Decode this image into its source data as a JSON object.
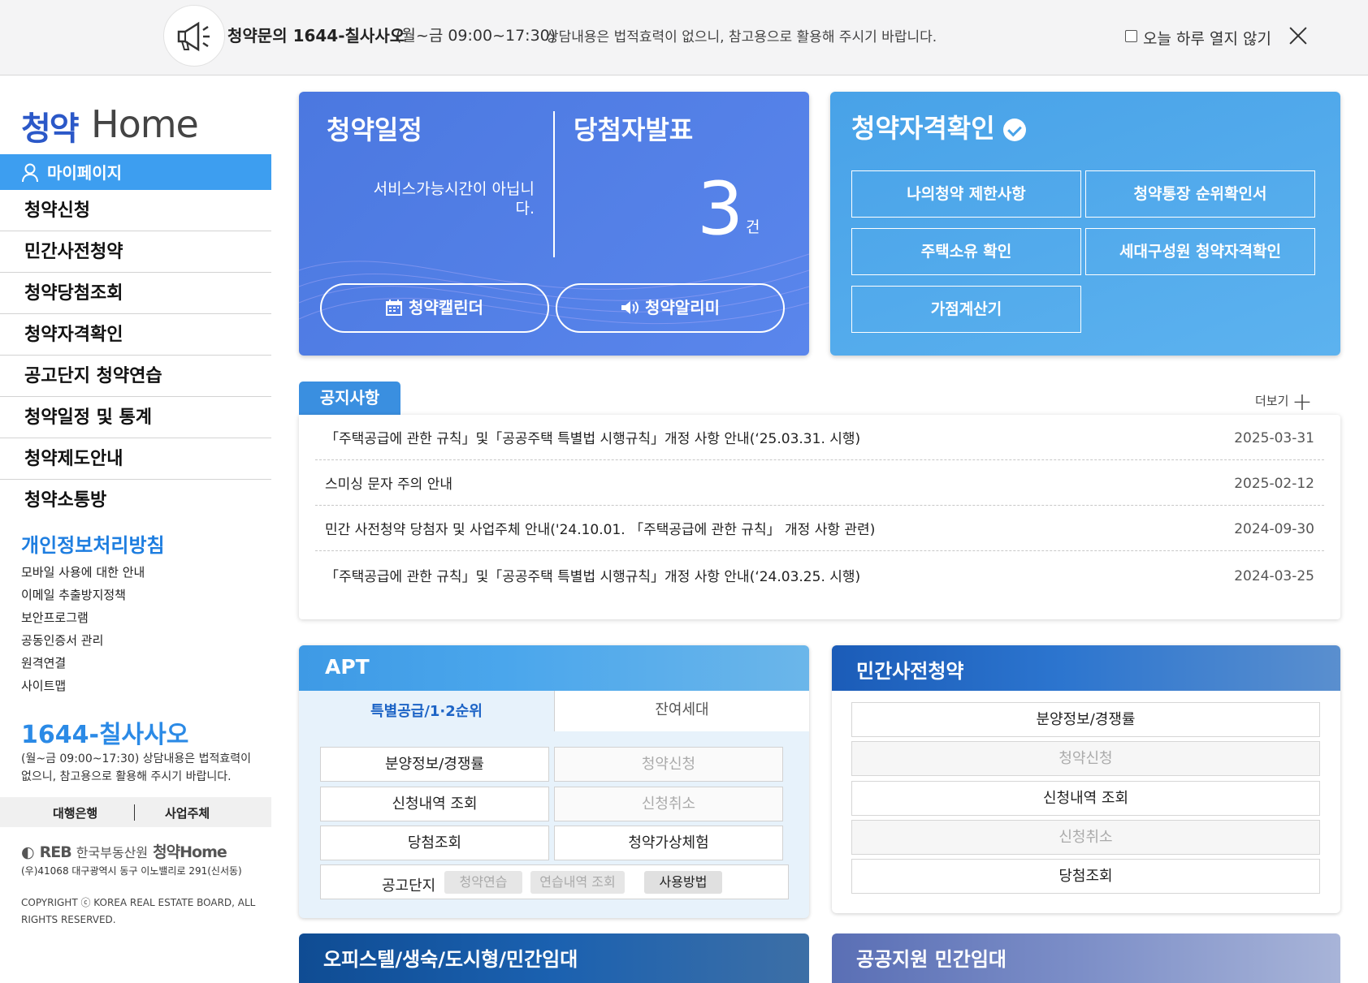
{
  "topbar": {
    "notice_bold": "청약문의 1644-칠사사오",
    "notice_hours": "(월~금 09:00~17:30)",
    "notice_desc": "상담내용은 법적효력이 없으니, 참고용으로 활용해 주시기 바랍니다.",
    "today_label": "오늘 하루 열지 않기"
  },
  "sidebar": {
    "logo_mark": "청약",
    "logo_home": "Home",
    "mypage": "마이페이지",
    "menu": [
      "청약신청",
      "민간사전청약",
      "청약당첨조회",
      "청약자격확인",
      "공고단지 청약연습",
      "청약일정 및 통계",
      "청약제도안내",
      "청약소통방"
    ],
    "privacy": "개인정보처리방침",
    "links": [
      "모바일 사용에 대한 안내",
      "이메일 추출방지정책",
      "보안프로그램",
      "공동인증서 관리",
      "원격연결",
      "사이트맵"
    ],
    "phone": "1644-칠사사오",
    "phone_desc": "(월~금 09:00~17:30) 상담내용은 법적효력이 없으니, 참고용으로 활용해 주시기 바랍니다.",
    "agency": [
      "대행은행",
      "사업주체"
    ],
    "footer_logo_reb": "REB",
    "footer_logo_name": "한국부동산원",
    "footer_logo_sub": "청약Home",
    "footer_addr": "(우)41068 대구광역시 동구 이노밸리로 291(신서동)",
    "footer_copy": "COPYRIGHT ⓒ KOREA REAL ESTATE BOARD, ALL RIGHTS RESERVED."
  },
  "schedule": {
    "title": "청약일정",
    "service_msg": "서비스가능시간이 아닙니다.",
    "winner_title": "당첨자발표",
    "winner_count": "3",
    "winner_unit": "건",
    "calendar_btn": "청약캘린더",
    "alarm_btn": "청약알리미"
  },
  "qualification": {
    "title": "청약자격확인",
    "buttons": [
      "나의청약 제한사항",
      "청약통장 순위확인서",
      "주택소유 확인",
      "세대구성원 청약자격확인",
      "가점계산기"
    ]
  },
  "notices": {
    "tab": "공지사항",
    "more": "더보기",
    "items": [
      {
        "title": "「주택공급에 관한 규칙」및「공공주택 특별법 시행규칙」개정 사항 안내(‘25.03.31. 시행)",
        "date": "2025-03-31"
      },
      {
        "title": "스미싱 문자 주의 안내",
        "date": "2025-02-12"
      },
      {
        "title": "민간 사전청약 당첨자 및 사업주체 안내('24.10.01. 「주택공급에 관한 규칙」 개정 사항 관련)",
        "date": "2024-09-30"
      },
      {
        "title": "「주택공급에 관한 규칙」및「공공주택 특별법 시행규칙」개정 사항 안내(‘24.03.25. 시행)",
        "date": "2024-03-25"
      }
    ]
  },
  "apt": {
    "title": "APT",
    "tab_active": "특별공급/1·2순위",
    "tab_other": "잔여세대",
    "buttons": [
      "분양정보/경쟁률",
      "청약신청",
      "신청내역 조회",
      "신청취소",
      "당첨조회",
      "청약가상체험"
    ],
    "row_label": "공고단지",
    "chips": [
      "청약연습",
      "연습내역 조회",
      "사용방법"
    ]
  },
  "private": {
    "title": "민간사전청약",
    "buttons": [
      "분양정보/경쟁률",
      "청약신청",
      "신청내역 조회",
      "신청취소",
      "당첨조회"
    ]
  },
  "officetel": {
    "title": "오피스텔/생숙/도시형/민간임대"
  },
  "public_rental": {
    "title": "공공지원 민간임대"
  },
  "colors": {
    "accent": "#3d9ef0",
    "schedule_bg": "#4f7ce4",
    "qual_bg": "#4fa9eb",
    "privacy": "#1e7ee0"
  }
}
